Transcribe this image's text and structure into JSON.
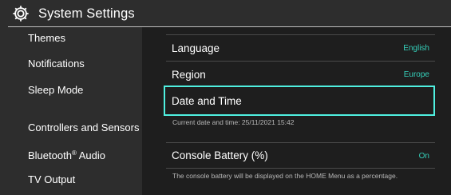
{
  "header": {
    "title": "System Settings",
    "icon": "gear-icon"
  },
  "sidebar": {
    "items": [
      {
        "label": "Themes"
      },
      {
        "label": "Notifications"
      },
      {
        "label": "Sleep Mode"
      },
      {
        "label": "Controllers and Sensors"
      },
      {
        "label": "Bluetooth",
        "sup": "®",
        "suffix": " Audio"
      },
      {
        "label": "TV Output"
      }
    ]
  },
  "main": {
    "language": {
      "label": "Language",
      "value": "English"
    },
    "region": {
      "label": "Region",
      "value": "Europe"
    },
    "date_time": {
      "label": "Date and Time",
      "description": "Current date and time: 25/11/2021 15:42"
    },
    "console_battery": {
      "label": "Console Battery (%)",
      "value": "On",
      "description": "The console battery will be displayed on the HOME Menu as a percentage."
    }
  },
  "colors": {
    "accent": "#35d0ba",
    "focus_border": "#4ff0e0",
    "panel_bg": "#1e1e1e",
    "sidebar_bg": "#2d2d2d"
  }
}
